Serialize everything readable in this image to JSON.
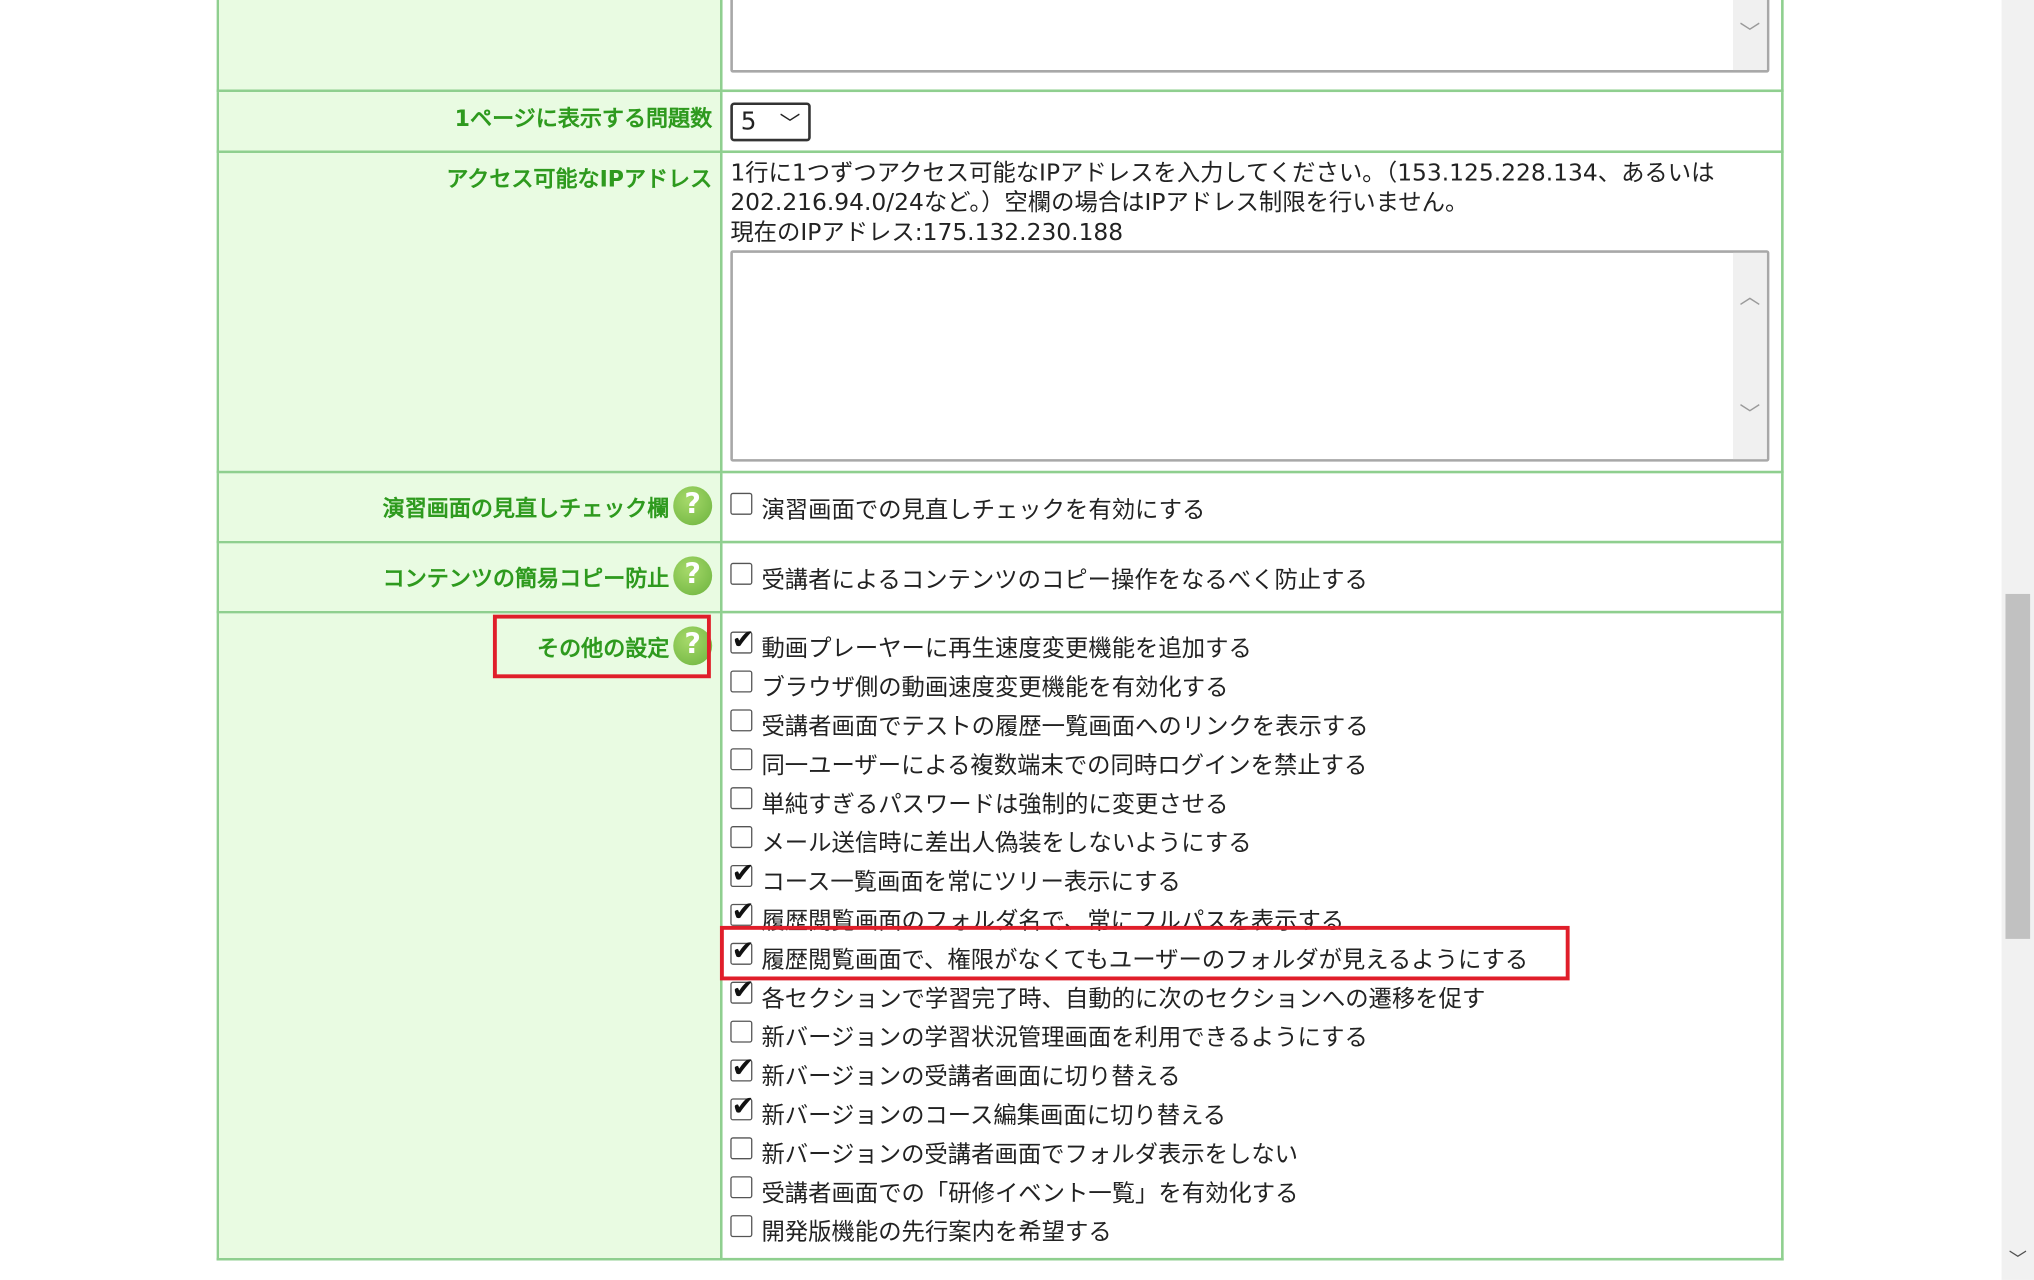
{
  "questions_per_page": {
    "label": "1ページに表示する問題数",
    "selected": "5"
  },
  "ip_access": {
    "label": "アクセス可能なIPアドレス",
    "description_line1": "1行に1つずつアクセス可能なIPアドレスを入力してください。（153.125.228.134、あるいは",
    "description_line2": "202.216.94.0/24など。）空欄の場合はIPアドレス制限を行いません。",
    "current_ip": "現在のIPアドレス:175.132.230.188",
    "value": ""
  },
  "review_check": {
    "label": "演習画面の見直しチェック欄",
    "option": {
      "label": "演習画面での見直しチェックを有効にする",
      "checked": false
    }
  },
  "copy_protect": {
    "label": "コンテンツの簡易コピー防止",
    "option": {
      "label": "受講者によるコンテンツのコピー操作をなるべく防止する",
      "checked": false
    }
  },
  "other_settings": {
    "label": "その他の設定",
    "options": [
      {
        "label": "動画プレーヤーに再生速度変更機能を追加する",
        "checked": true
      },
      {
        "label": "ブラウザ側の動画速度変更機能を有効化する",
        "checked": false
      },
      {
        "label": "受講者画面でテストの履歴一覧画面へのリンクを表示する",
        "checked": false
      },
      {
        "label": "同一ユーザーによる複数端末での同時ログインを禁止する",
        "checked": false
      },
      {
        "label": "単純すぎるパスワードは強制的に変更させる",
        "checked": false
      },
      {
        "label": "メール送信時に差出人偽装をしないようにする",
        "checked": false
      },
      {
        "label": "コース一覧画面を常にツリー表示にする",
        "checked": true
      },
      {
        "label": "履歴閲覧画面のフォルダ名で、常にフルパスを表示する",
        "checked": true
      },
      {
        "label": "履歴閲覧画面で、権限がなくてもユーザーのフォルダが見えるようにする",
        "checked": true
      },
      {
        "label": "各セクションで学習完了時、自動的に次のセクションへの遷移を促す",
        "checked": true
      },
      {
        "label": "新バージョンの学習状況管理画面を利用できるようにする",
        "checked": false
      },
      {
        "label": "新バージョンの受講者画面に切り替える",
        "checked": true
      },
      {
        "label": "新バージョンのコース編集画面に切り替える",
        "checked": true
      },
      {
        "label": "新バージョンの受講者画面でフォルダ表示をしない",
        "checked": false
      },
      {
        "label": "受講者画面での「研修イベント一覧」を有効化する",
        "checked": false
      },
      {
        "label": "開発版機能の先行案内を希望する",
        "checked": false
      }
    ]
  },
  "colors": {
    "label_bg": "#e9fbe2",
    "label_text": "#2e9a1e",
    "border": "#8fcf8f",
    "highlight": "#e01e2a"
  }
}
